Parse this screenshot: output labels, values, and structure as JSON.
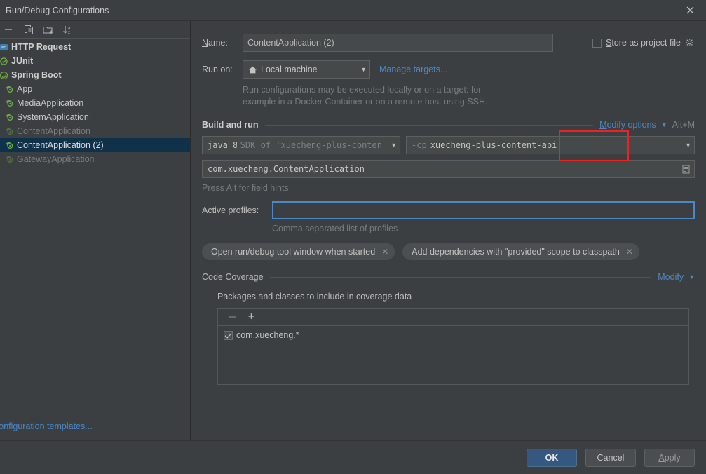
{
  "window": {
    "title": "Run/Debug Configurations",
    "close_icon": "close-icon"
  },
  "sidebar": {
    "toolbar": [
      {
        "icon": "minus-icon",
        "label": "Remove configuration"
      },
      {
        "icon": "copy-icon",
        "label": "Copy configuration"
      },
      {
        "icon": "folder-add-icon",
        "label": "Move into new folder"
      },
      {
        "icon": "sort-alphabetical-icon",
        "label": "Sort configurations"
      }
    ],
    "tree": [
      {
        "label": "HTTP Request",
        "type": "group",
        "icon": "http-request-icon",
        "dim": false,
        "selected": false
      },
      {
        "label": "JUnit",
        "type": "group",
        "icon": "junit-icon",
        "dim": false,
        "selected": false
      },
      {
        "label": "Spring Boot",
        "type": "group",
        "icon": "spring-boot-icon",
        "dim": false,
        "selected": false
      },
      {
        "label": "App",
        "type": "child",
        "icon": "spring-config-icon",
        "dim": false,
        "selected": false
      },
      {
        "label": "MediaApplication",
        "type": "child",
        "icon": "spring-config-icon",
        "dim": false,
        "selected": false
      },
      {
        "label": "SystemApplication",
        "type": "child",
        "icon": "spring-config-icon",
        "dim": false,
        "selected": false
      },
      {
        "label": "ContentApplication",
        "type": "child",
        "icon": "spring-config-icon",
        "dim": true,
        "selected": false
      },
      {
        "label": "ContentApplication (2)",
        "type": "child",
        "icon": "spring-config-icon",
        "dim": false,
        "selected": true
      },
      {
        "label": "GatewayApplication",
        "type": "child",
        "icon": "spring-config-icon",
        "dim": true,
        "selected": false
      }
    ],
    "edit_templates_link": "configuration templates..."
  },
  "form": {
    "name_label": "Name:",
    "name_value": "ContentApplication (2)",
    "store_as_project_file_label": "Store as project file",
    "store_as_project_file_checked": false,
    "store_gear_icon": "gear-icon",
    "run_on_label": "Run on:",
    "run_on_value": "Local machine",
    "run_on_icon": "home-icon",
    "manage_targets_link": "Manage targets...",
    "target_hint_line1": "Run configurations may be executed locally or on a target: for",
    "target_hint_line2": "example in a Docker Container or on a remote host using SSH."
  },
  "build_and_run": {
    "title": "Build and run",
    "modify_options_link": "Modify options",
    "modify_options_shortcut": "Alt+M",
    "modify_options_chevron": "chevron-down-icon",
    "sdk_prefix": "java 8",
    "sdk_suffix": "SDK of 'xuecheng-plus-content",
    "classpath_prefix": "-cp",
    "classpath_value": "xuecheng-plus-content-api",
    "main_class": "com.xuecheng.ContentApplication",
    "main_class_browse_icon": "browse-class-icon",
    "alt_hint": "Press Alt for field hints",
    "active_profiles_label": "Active profiles:",
    "active_profiles_value": "",
    "active_profiles_sub": "Comma separated list of profiles",
    "chips": [
      {
        "label": "Open run/debug tool window when started",
        "close_icon": "chip-close-icon"
      },
      {
        "label": "Add dependencies with \"provided\" scope to classpath",
        "close_icon": "chip-close-icon"
      }
    ]
  },
  "code_coverage": {
    "title": "Code Coverage",
    "modify_link": "Modify",
    "modify_chevron": "chevron-down-icon",
    "packages_title": "Packages and classes to include in coverage data",
    "toolbar": [
      {
        "icon": "minus-icon",
        "label": "Remove pattern"
      },
      {
        "icon": "plus-dropdown-icon",
        "label": "Add pattern"
      }
    ],
    "items": [
      {
        "label": "com.xuecheng.*",
        "checked": true
      }
    ]
  },
  "footer": {
    "ok_label": "OK",
    "cancel_label": "Cancel",
    "apply_label": "Apply"
  },
  "annotation": {
    "type": "red-rectangle",
    "color": "#f32020",
    "target": "Modify options"
  },
  "colors": {
    "background": "#3c3f41",
    "selection": "#10314a",
    "link": "#4a88c7",
    "accent_button": "#365880",
    "field_background": "#45494a",
    "annotation_red": "#f32020",
    "spring_green": "#6cab3e"
  }
}
